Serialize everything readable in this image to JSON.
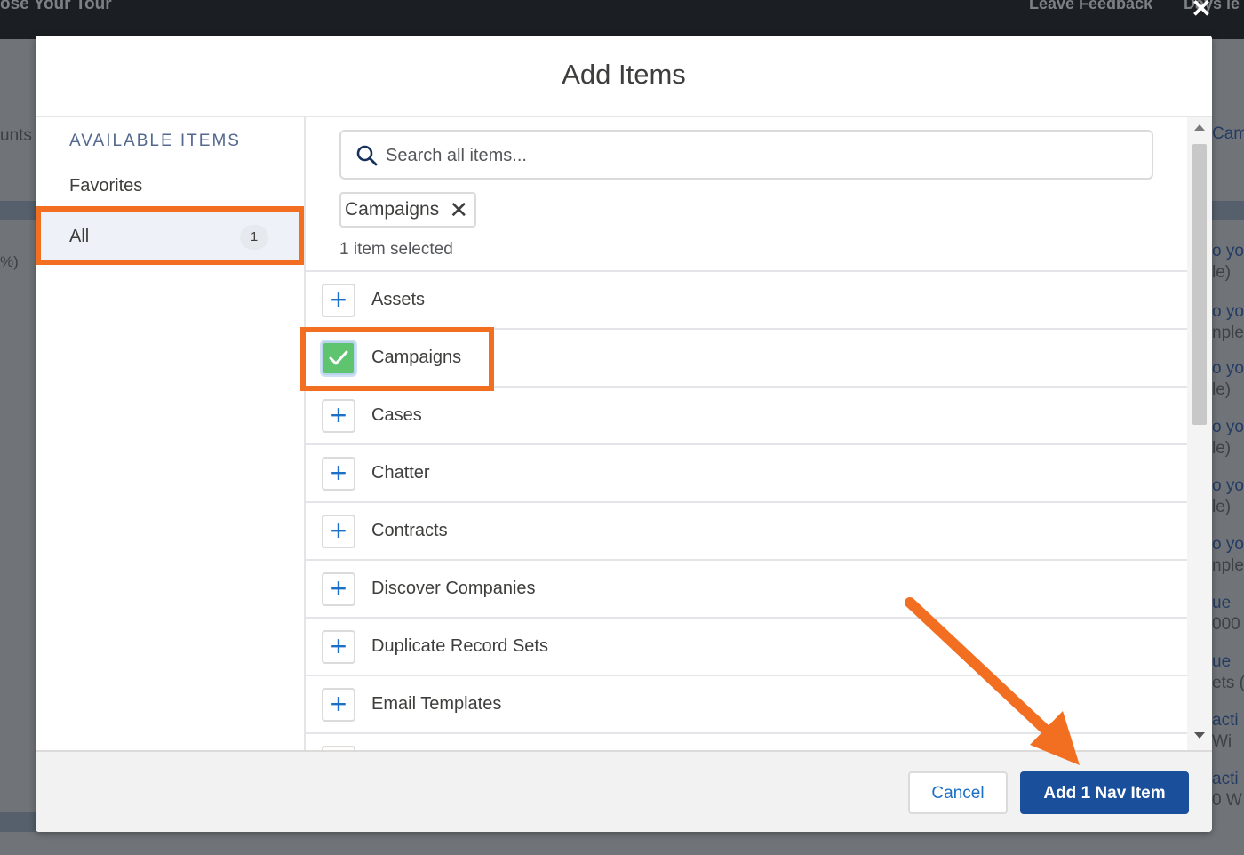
{
  "background": {
    "top_left_text": "ose Your Tour",
    "top_right_text": "Leave Feedback",
    "top_days_text": "Days le",
    "close_glyph": "✕",
    "left_text": "unts",
    "left_pct": "%)",
    "right_fragments": [
      "Cam",
      "o yo",
      "le)",
      "o yo",
      "nple",
      "o yo",
      "le)",
      "o yo",
      "le)",
      "o yo",
      "le)",
      "o yo",
      "nple",
      "ue",
      "000",
      "ue",
      "ets (",
      "acti",
      "Wi",
      "acti",
      "0 W"
    ]
  },
  "modal": {
    "title": "Add Items",
    "left_pane": {
      "heading": "AVAILABLE ITEMS",
      "favorites_label": "Favorites",
      "all_label": "All",
      "all_count": "1"
    },
    "search": {
      "placeholder": "Search all items..."
    },
    "selected_pill": {
      "label": "Campaigns",
      "remove_glyph": "✕"
    },
    "selected_count_text": "1 item selected",
    "items": [
      {
        "label": "Assets",
        "checked": false
      },
      {
        "label": "Campaigns",
        "checked": true
      },
      {
        "label": "Cases",
        "checked": false
      },
      {
        "label": "Chatter",
        "checked": false
      },
      {
        "label": "Contracts",
        "checked": false
      },
      {
        "label": "Discover Companies",
        "checked": false
      },
      {
        "label": "Duplicate Record Sets",
        "checked": false
      },
      {
        "label": "Email Templates",
        "checked": false
      }
    ],
    "footer": {
      "cancel_label": "Cancel",
      "add_label": "Add 1 Nav Item"
    }
  },
  "colors": {
    "highlight": "#f26f22",
    "brand_blue": "#1a4f9c",
    "check_green": "#5ec470",
    "selection_bar": "#0070d2"
  },
  "icons": {
    "add": "plus-icon",
    "checked": "check-icon",
    "search": "search-icon",
    "remove": "close-icon"
  }
}
